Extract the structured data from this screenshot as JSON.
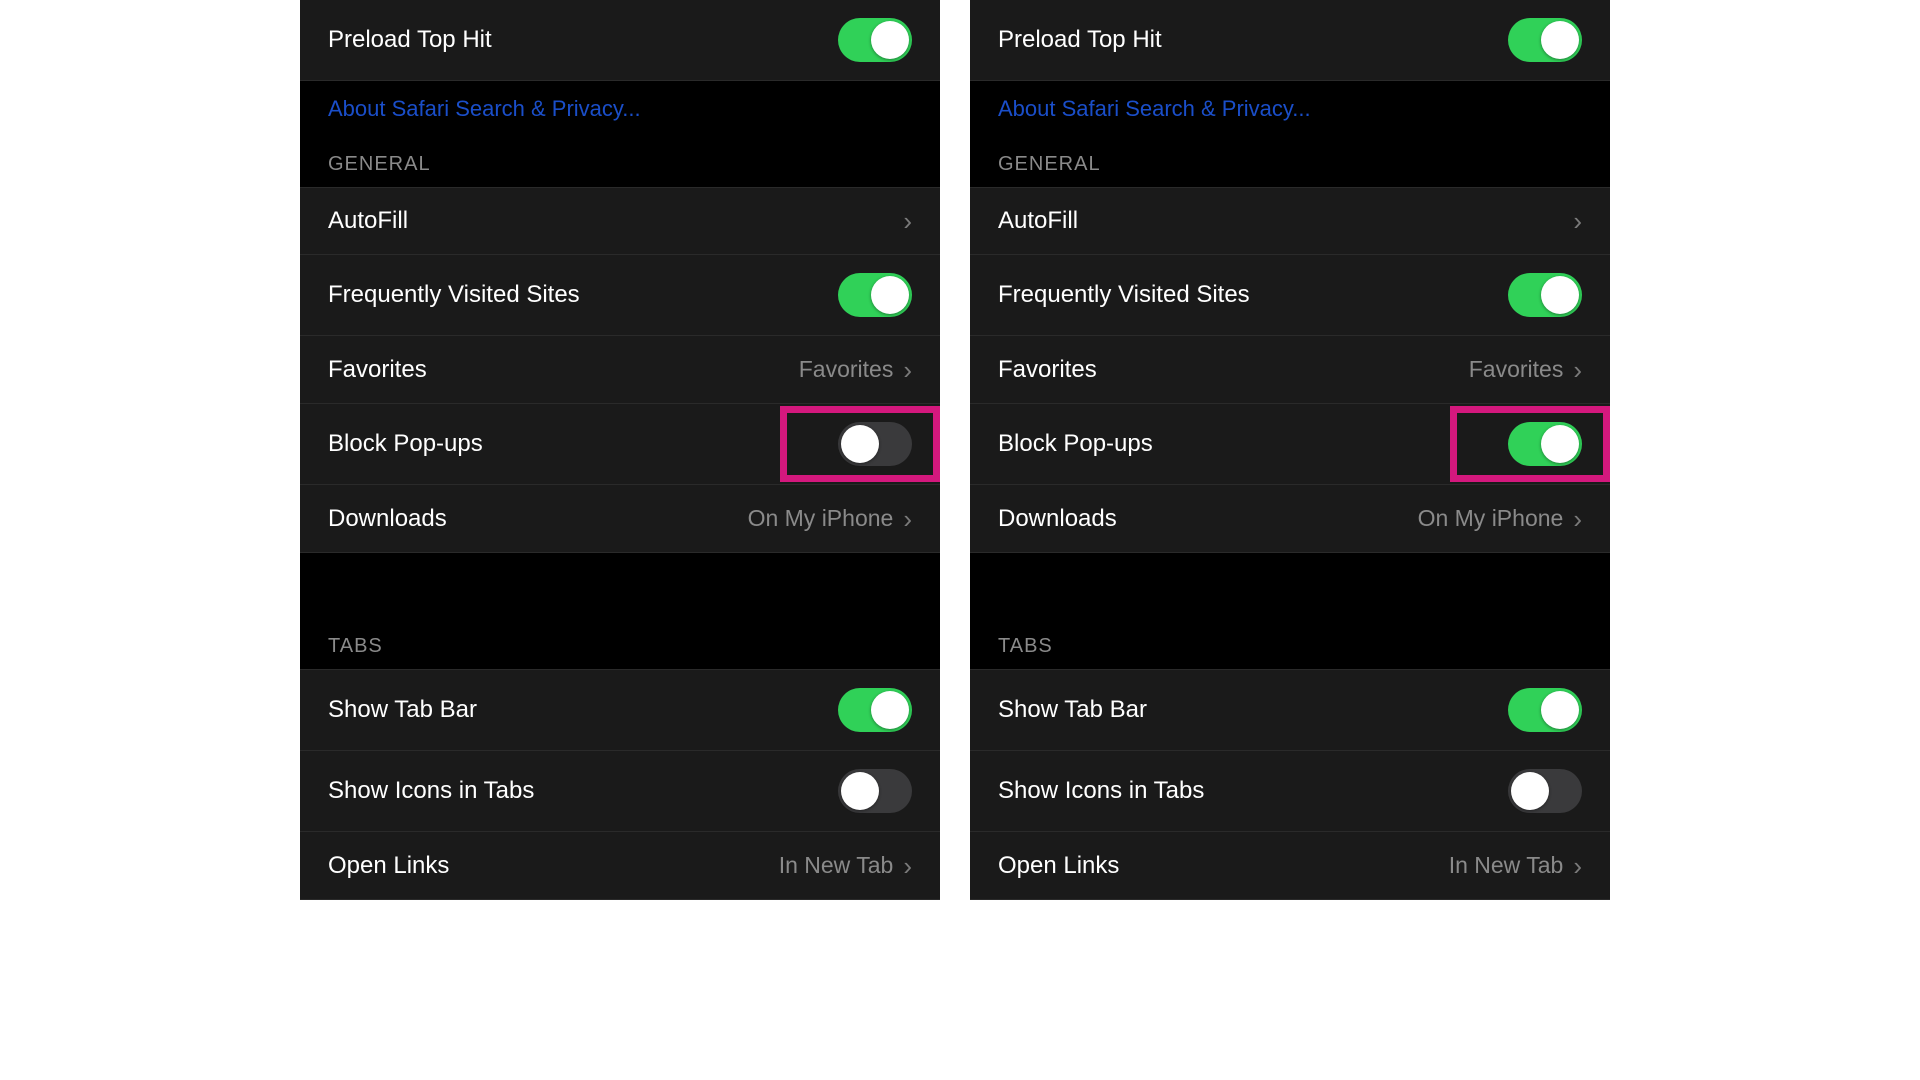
{
  "colors": {
    "highlight": "#d4187d",
    "toggle_on": "#30d158",
    "toggle_off": "#3a3a3c",
    "link": "#1a4ec9"
  },
  "panels": [
    {
      "id": "left",
      "preload_top_hit": {
        "label": "Preload Top Hit",
        "on": true
      },
      "about_link": "About Safari Search & Privacy...",
      "sections": {
        "general": {
          "header": "GENERAL",
          "autofill": {
            "label": "AutoFill"
          },
          "freq_visited": {
            "label": "Frequently Visited Sites",
            "on": true
          },
          "favorites": {
            "label": "Favorites",
            "value": "Favorites"
          },
          "block_popups": {
            "label": "Block Pop-ups",
            "on": false,
            "highlighted": true
          },
          "downloads": {
            "label": "Downloads",
            "value": "On My iPhone"
          }
        },
        "tabs": {
          "header": "TABS",
          "show_tab_bar": {
            "label": "Show Tab Bar",
            "on": true
          },
          "show_icons": {
            "label": "Show Icons in Tabs",
            "on": false
          },
          "open_links": {
            "label": "Open Links",
            "value": "In New Tab"
          }
        }
      }
    },
    {
      "id": "right",
      "preload_top_hit": {
        "label": "Preload Top Hit",
        "on": true
      },
      "about_link": "About Safari Search & Privacy...",
      "sections": {
        "general": {
          "header": "GENERAL",
          "autofill": {
            "label": "AutoFill"
          },
          "freq_visited": {
            "label": "Frequently Visited Sites",
            "on": true
          },
          "favorites": {
            "label": "Favorites",
            "value": "Favorites"
          },
          "block_popups": {
            "label": "Block Pop-ups",
            "on": true,
            "highlighted": true
          },
          "downloads": {
            "label": "Downloads",
            "value": "On My iPhone"
          }
        },
        "tabs": {
          "header": "TABS",
          "show_tab_bar": {
            "label": "Show Tab Bar",
            "on": true
          },
          "show_icons": {
            "label": "Show Icons in Tabs",
            "on": false
          },
          "open_links": {
            "label": "Open Links",
            "value": "In New Tab"
          }
        }
      }
    }
  ]
}
